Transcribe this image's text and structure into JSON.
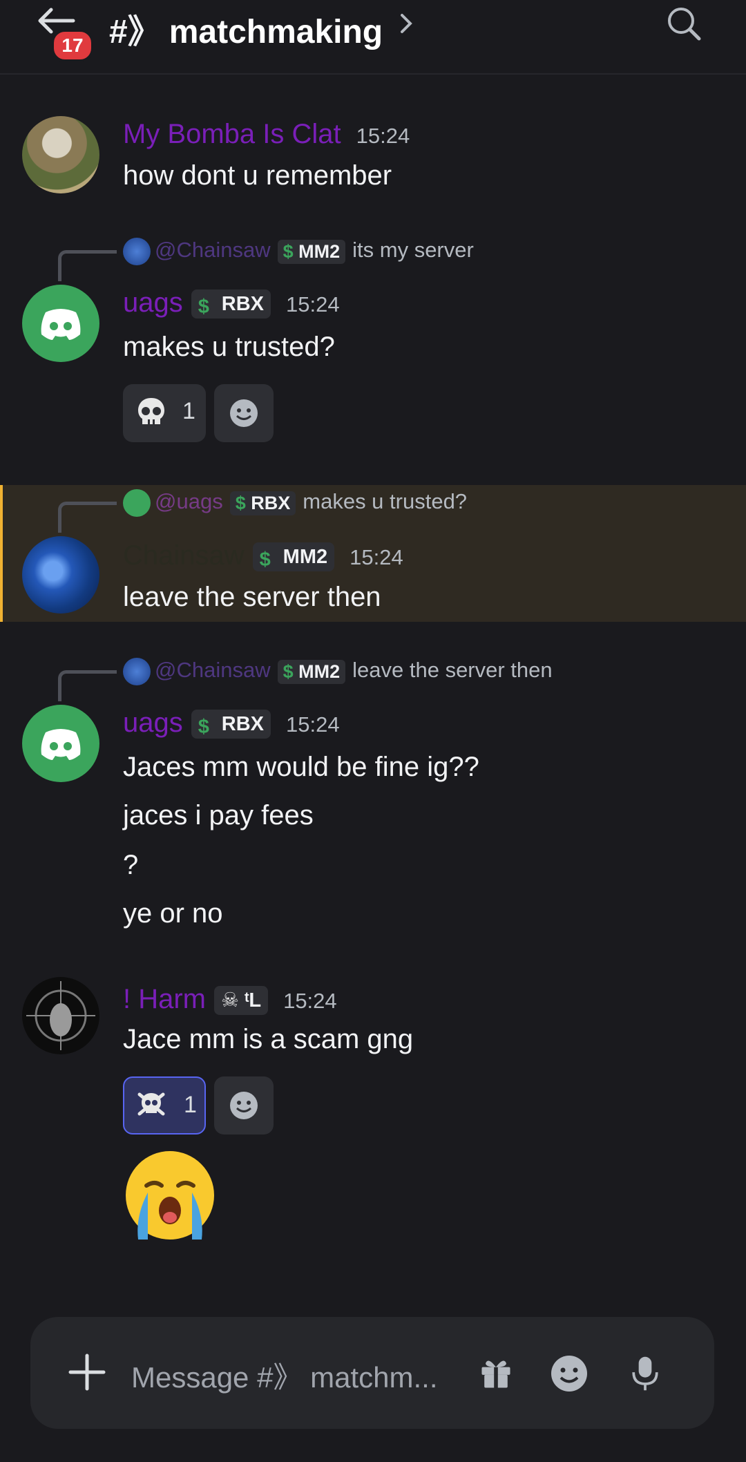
{
  "header": {
    "unread_count": "17",
    "channel_prefix": "#》",
    "channel_name": "matchmaking"
  },
  "colors": {
    "background": "#1a1a1e",
    "role_purple": "#7a1fb8",
    "highlight_bg": "#2f2a22",
    "highlight_bar": "#f0b232",
    "discord_green": "#3ba55c",
    "mention_badge": "#e03a3e"
  },
  "messages": [
    {
      "author": "My Bomba Is Clat",
      "time": "15:24",
      "lines": [
        "how dont u remember"
      ]
    },
    {
      "reply": {
        "name": "@Chainsaw",
        "tag": "MM2",
        "text": "its my server"
      },
      "author": "uags",
      "tag": "RBX",
      "time": "15:24",
      "lines": [
        "makes u trusted?"
      ],
      "reaction": {
        "emoji": "skull",
        "count": "1"
      }
    },
    {
      "reply": {
        "name": "@uags",
        "tag": "RBX",
        "text": "makes u trusted?"
      },
      "author": "Chainsaw",
      "tag": "MM2",
      "time": "15:24",
      "lines": [
        "leave the server then"
      ],
      "highlighted": true
    },
    {
      "reply": {
        "name": "@Chainsaw",
        "tag": "MM2",
        "text": "leave the server then"
      },
      "author": "uags",
      "tag": "RBX",
      "time": "15:24",
      "lines": [
        "Jaces mm would be fine ig??",
        "jaces i pay fees",
        "?",
        "ye or no"
      ]
    },
    {
      "author": "! Harm",
      "tag": "ᵗL",
      "time": "15:24",
      "lines": [
        "Jace mm is a scam gng"
      ],
      "reaction": {
        "emoji": "skull-and-crossbones",
        "count": "1"
      },
      "big_emoji": "loudly-crying-face"
    }
  ],
  "composer": {
    "placeholder": "Message #》 matchm..."
  }
}
